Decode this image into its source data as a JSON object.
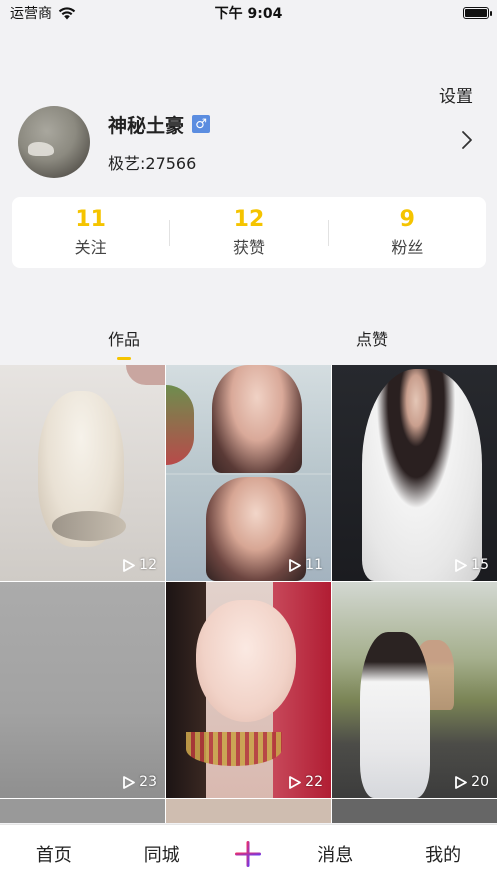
{
  "status_bar": {
    "carrier": "运营商",
    "time": "下午 9:04",
    "battery_level": 1.0
  },
  "header": {
    "settings_label": "设置"
  },
  "profile": {
    "name": "神秘土豪",
    "gender_symbol": "♂",
    "user_id": "极艺:27566"
  },
  "stats": [
    {
      "value": "11",
      "label": "关注"
    },
    {
      "value": "12",
      "label": "获赞"
    },
    {
      "value": "9",
      "label": "粉丝"
    }
  ],
  "tabs": [
    {
      "label": "作品",
      "active": true
    },
    {
      "label": "点赞",
      "active": false
    }
  ],
  "videos": [
    {
      "plays": "12"
    },
    {
      "plays": "11"
    },
    {
      "plays": "15"
    },
    {
      "plays": "23"
    },
    {
      "plays": "22"
    },
    {
      "plays": "20"
    }
  ],
  "tab_bar": {
    "items": [
      "首页",
      "同城",
      "消息",
      "我的"
    ],
    "center_icon": "plus-icon"
  },
  "colors": {
    "accent_yellow": "#f5c400",
    "gender_blue": "#5b8de0",
    "plus_gradient_start": "#ff2d55",
    "plus_gradient_end": "#5a3cff"
  }
}
